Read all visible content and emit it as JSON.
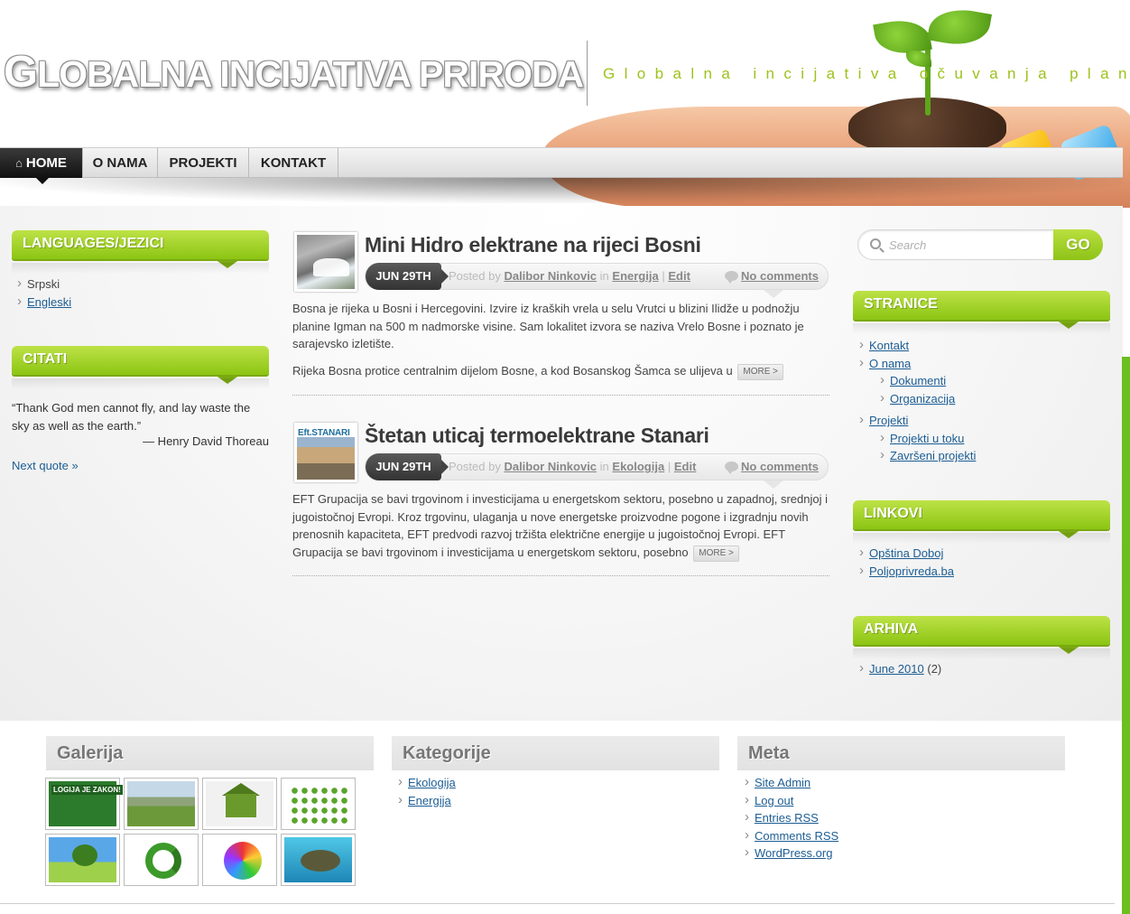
{
  "site": {
    "title_first": "G",
    "title_rest": "LOBALNA INCIJATIVA PRIRODA",
    "tagline": "Globalna incijativa očuvanja planete"
  },
  "nav": {
    "items": [
      {
        "label": "HOME",
        "active": true
      },
      {
        "label": "O NAMA"
      },
      {
        "label": "PROJEKTI"
      },
      {
        "label": "KONTAKT"
      }
    ]
  },
  "left_sidebar": {
    "languages": {
      "title": "LANGUAGES/JEZICI",
      "items": [
        {
          "label": "Srpski",
          "link": false
        },
        {
          "label": "Engleski",
          "link": true
        }
      ]
    },
    "citati": {
      "title": "CITATI",
      "quote": "“Thank God men cannot fly, and lay waste the sky as well as the earth.”",
      "author": "— Henry David Thoreau",
      "next_label": "Next quote »"
    }
  },
  "posts": [
    {
      "title": "Mini Hidro elektrane na rijeci Bosni",
      "date": "JUN 29TH",
      "posted_by_label": "Posted by",
      "author": "Dalibor Ninkovic",
      "in_label": "in",
      "category": "Energija",
      "sep": "|",
      "edit_label": "Edit",
      "comments": "No comments",
      "paragraphs": [
        "Bosna je rijeka u Bosni i Hercegovini. Izvire iz kraških vrela u selu Vrutci u blizini Ilidže  u podnožju planine Igman na 500 m nadmorske visine. Sam lokalitet izvora se naziva Vrelo Bosne i poznato je sarajevsko  izletište.",
        "Rijeka Bosna protice centralnim dijelom Bosne, a kod Bosanskog Šamca se ulijeva u"
      ],
      "more_label": "MORE >"
    },
    {
      "title": "Štetan uticaj termoelektrane Stanari",
      "date": "JUN 29TH",
      "posted_by_label": "Posted by",
      "author": "Dalibor Ninkovic",
      "in_label": "in",
      "category": "Ekologija",
      "sep": "|",
      "edit_label": "Edit",
      "comments": "No comments",
      "thumb_label": "Eft.STANARI",
      "paragraphs": [
        "EFT Grupacija se bavi trgovinom i investicijama u energetskom sektoru, posebno u zapadnoj, srednjoj i jugoistočnoj Evropi. Kroz trgovinu, ulaganja u nove energetske proizvodne pogone i izgradnju novih prenosnih kapaciteta, EFT predvodi razvoj tržišta električne energije u jugoistočnoj Evropi. EFT Grupacija se bavi trgovinom i investicijama u energetskom sektoru, posebno"
      ],
      "more_label": "MORE >"
    }
  ],
  "right_sidebar": {
    "search": {
      "placeholder": "Search",
      "button": "GO"
    },
    "stranice": {
      "title": "STRANICE",
      "items": [
        {
          "label": "Kontakt",
          "level": 0
        },
        {
          "label": "O nama",
          "level": 0
        },
        {
          "label": "Dokumenti",
          "level": 1
        },
        {
          "label": "Organizacija",
          "level": 1
        },
        {
          "label": "Projekti",
          "level": 0
        },
        {
          "label": "Projekti u toku",
          "level": 1
        },
        {
          "label": "Završeni projekti",
          "level": 1
        }
      ]
    },
    "linkovi": {
      "title": "LINKOVI",
      "items": [
        "Opština Doboj",
        "Poljoprivreda.ba"
      ]
    },
    "arhiva": {
      "title": "ARHIVA",
      "items": [
        {
          "label": "June 2010",
          "count": "(2)"
        }
      ]
    }
  },
  "footer": {
    "galerija": {
      "title": "Galerija",
      "thumbs": [
        "LOGIJA JE ZAKON!",
        "",
        "",
        "",
        "",
        "",
        "",
        ""
      ]
    },
    "kategorije": {
      "title": "Kategorije",
      "items": [
        "Ekologija",
        "Energija"
      ]
    },
    "meta": {
      "title": "Meta",
      "items": [
        "Site Admin",
        "Log out",
        "Entries RSS",
        "Comments RSS",
        "WordPress.org"
      ]
    }
  },
  "colors": {
    "accent_green": "#9cc21a",
    "link_blue": "#1c5d93",
    "nav_active": "#222222"
  }
}
